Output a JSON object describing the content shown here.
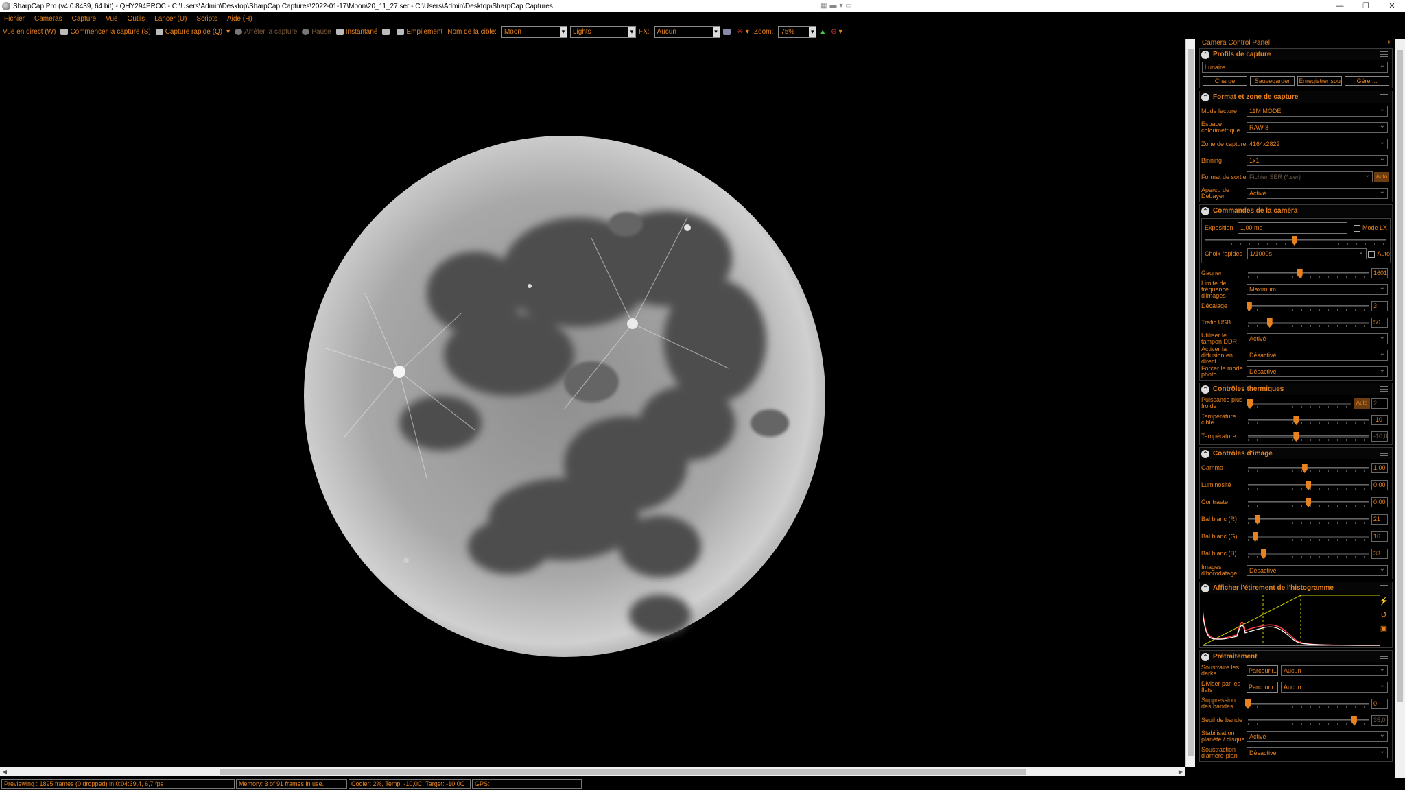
{
  "window": {
    "title": "SharpCap Pro (v4.0.8439, 64 bit) - QHY294PROC - C:\\Users\\Admin\\Desktop\\SharpCap Captures\\2022-01-17\\Moon\\20_11_27.ser - C:\\Users\\Admin\\Desktop\\SharpCap Captures",
    "minimize": "—",
    "maximize": "❐",
    "close": "✕"
  },
  "menu": [
    "Fichier",
    "Cameras",
    "Capture",
    "Vue",
    "Outils",
    "Lancer (U)",
    "Scripts",
    "Aide (H)"
  ],
  "toolbar": {
    "live_view": "Vue en direct (W)",
    "start_capture": "Commencer la capture (S)",
    "quick_capture": "Capture rapide (Q)",
    "stop_capture": "Arrêter la capture",
    "pause": "Pause",
    "snapshot": "Instantané",
    "stacking": "Empilement",
    "target_label": "Nom de la cible:",
    "target_value": "Moon",
    "frame_type": "Lights",
    "fx_label": "FX:",
    "fx_value": "Aucun",
    "zoom_label": "Zoom:",
    "zoom_value": "75%"
  },
  "panel": {
    "title": "Camera Control Panel",
    "pin": "ᵖ",
    "profiles": {
      "title": "Profils de capture",
      "selected": "Lunaire",
      "buttons": [
        "Charge",
        "Sauvegarder",
        "Enregistrer sou",
        "Gérer..."
      ]
    },
    "format": {
      "title": "Format et zone de capture",
      "rows": [
        {
          "label": "Mode lecture",
          "value": "11M MODE"
        },
        {
          "label": "Espace colorimétrique",
          "value": "RAW 8"
        },
        {
          "label": "Zone de capture",
          "value": "4164x2822"
        },
        {
          "label": "Binning",
          "value": "1x1"
        },
        {
          "label": "Format de sortie",
          "value": "Fichier SER (*.ser)",
          "extra": "Auto"
        },
        {
          "label": "Aperçu de Debayer",
          "value": "Activé"
        }
      ]
    },
    "camera": {
      "title": "Commandes de la caméra",
      "exposure_label": "Exposition",
      "exposure_value": "1,00 ms",
      "lx_label": "Mode LX",
      "quick_label": "Choix rapides",
      "quick_value": "1/1000s",
      "auto_label": "Auto",
      "gain": {
        "label": "Gagner",
        "value": "1601",
        "pos": 0.43
      },
      "framerate": {
        "label": "Limite de fréquence d'images",
        "value": "Maximum"
      },
      "offset": {
        "label": "Décalage",
        "value": "3",
        "pos": 0.01
      },
      "usb": {
        "label": "Trafic USB",
        "value": "50",
        "pos": 0.18
      },
      "ddr": {
        "label": "Utiliser le tampon DDR",
        "value": "Activé"
      },
      "broadcast": {
        "label": "Activer la diffusion en direct",
        "value": "Désactivé"
      },
      "photo": {
        "label": "Forcer le mode photo",
        "value": "Désactivé"
      }
    },
    "thermal": {
      "title": "Contrôles thermiques",
      "cooler": {
        "label": "Puissance plus froide",
        "value": "2",
        "auto": "Auto",
        "pos": 0.02
      },
      "target": {
        "label": "Température cible",
        "value": "-10",
        "pos": 0.4
      },
      "temp": {
        "label": "Température",
        "value": "-10,0",
        "pos": 0.4
      }
    },
    "image": {
      "title": "Contrôles d'image",
      "rows": [
        {
          "label": "Gamma",
          "value": "1,00",
          "pos": 0.47
        },
        {
          "label": "Luminosité",
          "value": "0,00",
          "pos": 0.5
        },
        {
          "label": "Contraste",
          "value": "0,00",
          "pos": 0.5
        },
        {
          "label": "Bal blanc (R)",
          "value": "21",
          "pos": 0.08
        },
        {
          "label": "Bal blanc (G)",
          "value": "16",
          "pos": 0.06
        },
        {
          "label": "Bal blanc (B)",
          "value": "33",
          "pos": 0.13
        }
      ],
      "timestamp": {
        "label": "Images d'horodatage",
        "value": "Désactivé"
      }
    },
    "histogram": {
      "title": "Afficher l'étirement de l'histogramme"
    },
    "preprocess": {
      "title": "Prétraitement",
      "darks": {
        "label": "Soustraire les darks",
        "browse": "Parcourir...",
        "value": "Aucun"
      },
      "flats": {
        "label": "Diviser par les flats",
        "browse": "Parcourir...",
        "value": "Aucun"
      },
      "banding": {
        "label": "Suppression des bandes",
        "value": "0",
        "pos": 0.0
      },
      "threshold": {
        "label": "Seuil de bande",
        "value": "35,0",
        "pos": 0.88
      },
      "stabilize": {
        "label": "Stabilisation planète / disque",
        "value": "Activé"
      },
      "background": {
        "label": "Soustraction d'arrière-plan",
        "value": "Désactivé"
      }
    }
  },
  "status": {
    "preview": "Previewing : 1895 frames (0 dropped) in 0:04:39,4, 6,7 fps",
    "memory": "Memory: 3 of 91 frames in use.",
    "cooler": "Cooler: 2%, Temp: -10,0C, Target: -10,0C",
    "gps": "GPS:"
  },
  "colors": {
    "accent": "#e8821e",
    "background": "#000000"
  },
  "icons": {
    "close": "close-icon",
    "collapse": "chevron-up-icon"
  }
}
